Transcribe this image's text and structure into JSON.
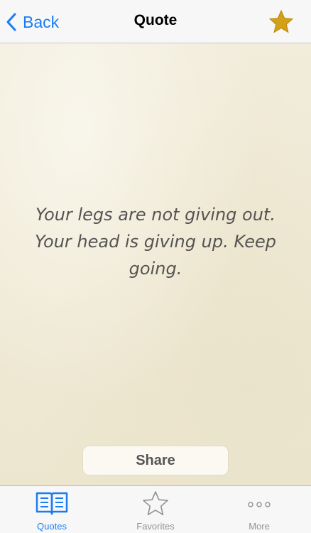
{
  "navbar": {
    "back_label": "Back",
    "title": "Quote",
    "favorite_icon": "star-filled-icon",
    "favorite_color": "#d4a017"
  },
  "quote": {
    "text": "Your legs are not giving out. Your head is giving up. Keep going."
  },
  "actions": {
    "share_label": "Share"
  },
  "tabbar": {
    "tabs": [
      {
        "label": "Quotes",
        "icon": "book-icon",
        "active": true
      },
      {
        "label": "Favorites",
        "icon": "star-outline-icon",
        "active": false
      },
      {
        "label": "More",
        "icon": "more-dots-icon",
        "active": false
      }
    ]
  },
  "colors": {
    "accent": "#1a7cf5",
    "inactive": "#929292",
    "parchment": "#f1ecdb"
  }
}
